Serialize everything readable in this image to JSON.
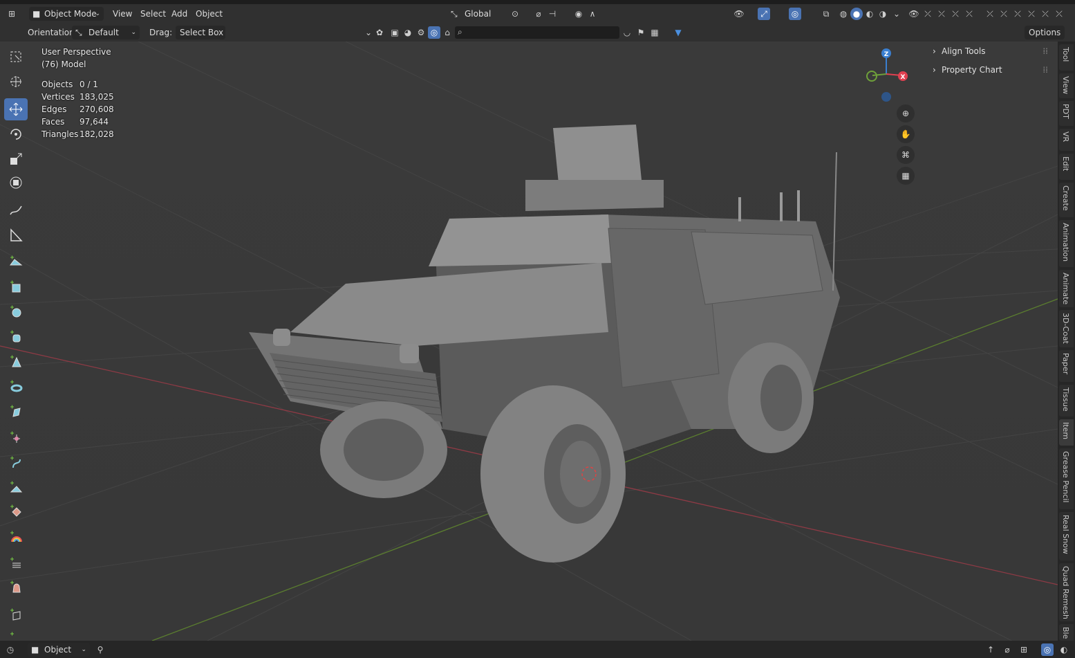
{
  "header": {
    "mode_label": "Object Mode",
    "menus": [
      "View",
      "Select",
      "Add",
      "Object"
    ],
    "transform_orientation": "Global"
  },
  "toolsettings": {
    "orientation_label": "Orientation:",
    "orientation_value": "Default",
    "drag_label": "Drag:",
    "drag_value": "Select Box",
    "options_label": "Options"
  },
  "overlay": {
    "view_name": "User Perspective",
    "collection": "(76) Model",
    "stats": [
      {
        "label": "Objects",
        "value": "0 / 1"
      },
      {
        "label": "Vertices",
        "value": "183,025"
      },
      {
        "label": "Edges",
        "value": "270,608"
      },
      {
        "label": "Faces",
        "value": "97,644"
      },
      {
        "label": "Triangles",
        "value": "182,028"
      }
    ]
  },
  "gizmo": {
    "z": "Z",
    "x": "X"
  },
  "npanel": {
    "panels": [
      "Align Tools",
      "Property Chart"
    ]
  },
  "sidebar_tabs": [
    "Tool",
    "View",
    "PDT",
    "VR",
    "Edit",
    "Create",
    "Animation",
    "Animate",
    "3D-Coat",
    "Paper",
    "Tissue",
    "Item",
    "Grease Pencil",
    "Real Snow",
    "Quad Remesh",
    "Ble"
  ],
  "statusbar": {
    "object_label": "Object"
  },
  "colors": {
    "accent": "#4a73b3",
    "x_axis": "#e04050",
    "y_axis": "#6fa13a",
    "z_axis": "#3a7fd0",
    "viewport_bg": "#3c3c3c"
  }
}
